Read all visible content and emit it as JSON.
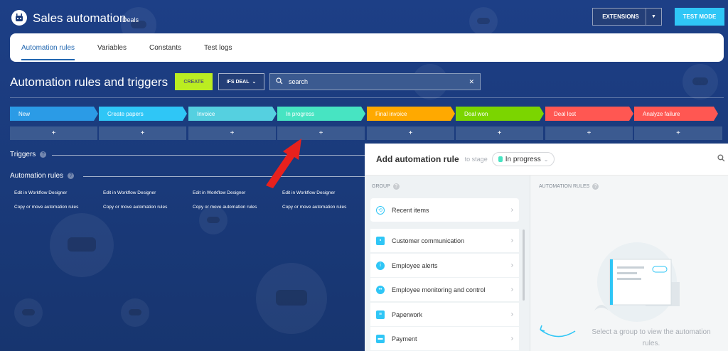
{
  "header": {
    "title": "Sales automation",
    "subtitle": "Deals",
    "extensions_label": "EXTENSIONS",
    "test_mode_label": "TEST MODE"
  },
  "tabs": [
    {
      "label": "Automation rules",
      "active": true
    },
    {
      "label": "Variables",
      "active": false
    },
    {
      "label": "Constants",
      "active": false
    },
    {
      "label": "Test logs",
      "active": false
    }
  ],
  "toolbar": {
    "heading": "Automation rules and triggers",
    "create_label": "CREATE",
    "pipeline_label": "IFS DEAL",
    "search_value": "search"
  },
  "stages": [
    {
      "label": "New",
      "color": "#2b9be6"
    },
    {
      "label": "Create papers",
      "color": "#2fc6f6"
    },
    {
      "label": "Invoice",
      "color": "#55d0e0"
    },
    {
      "label": "In progress",
      "color": "#47e4c2"
    },
    {
      "label": "Final invoice",
      "color": "#ffa900"
    },
    {
      "label": "Deal won",
      "color": "#7bd500"
    },
    {
      "label": "Deal lost",
      "color": "#ff5752"
    },
    {
      "label": "Analyze failure",
      "color": "#ff5752"
    }
  ],
  "plus_label": "+",
  "sections": {
    "triggers": "Triggers",
    "automation_rules": "Automation rules"
  },
  "rule_links": {
    "edit": "Edit in Workflow Designer",
    "copy": "Copy or move automation rules"
  },
  "panel": {
    "title": "Add automation rule",
    "to_stage": "to stage",
    "stage": "In progress",
    "group_label": "GROUP",
    "rules_label": "AUTOMATION RULES",
    "groups": [
      {
        "label": "Recent items",
        "icon": "history-icon"
      },
      {
        "label": "Customer communication",
        "icon": "chat-icon"
      },
      {
        "label": "Employee alerts",
        "icon": "info-icon"
      },
      {
        "label": "Employee monitoring and control",
        "icon": "people-icon"
      },
      {
        "label": "Paperwork",
        "icon": "document-icon"
      },
      {
        "label": "Payment",
        "icon": "wallet-icon"
      }
    ],
    "empty_text": "Select a group to view the automation rules."
  }
}
